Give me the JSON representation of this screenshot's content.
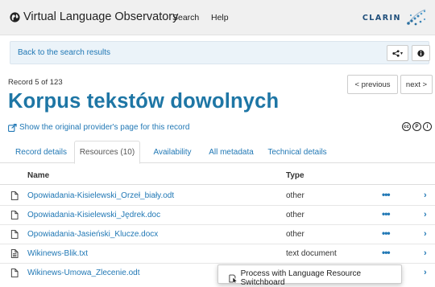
{
  "navbar": {
    "brand": "Virtual Language Observatory",
    "links": [
      "Search",
      "Help"
    ],
    "partner_logo_text": "CLARIN"
  },
  "searchbar": {
    "back_label": "Back to the search results",
    "share_icon": "share-icon",
    "info_icon": "info-icon"
  },
  "record": {
    "count_label": "Record 5 of 123",
    "prev_label": "< previous",
    "next_label": "next >",
    "title": "Korpus tekstów dowolnych",
    "provider_link": "Show the original provider's page for this record",
    "license_icons": [
      "cc",
      "P",
      "i"
    ]
  },
  "tabs": [
    {
      "label": "Record details",
      "active": false
    },
    {
      "label": "Resources (10)",
      "active": true
    },
    {
      "label": "Availability",
      "active": false
    },
    {
      "label": "All metadata",
      "active": false
    },
    {
      "label": "Technical details",
      "active": false
    }
  ],
  "resources": {
    "headers": {
      "name": "Name",
      "type": "Type"
    },
    "rows": [
      {
        "name": "Opowiadania-Kisielewski_Orzeł_biały.odt",
        "type": "other",
        "icon": "file-icon"
      },
      {
        "name": "Opowiadania-Kisielewski_Jędrek.doc",
        "type": "other",
        "icon": "file-icon"
      },
      {
        "name": "Opowiadania-Jasieński_Klucze.docx",
        "type": "other",
        "icon": "file-icon"
      },
      {
        "name": "Wikinews-Blik.txt",
        "type": "text document",
        "icon": "file-text-icon"
      },
      {
        "name": "Wikinews-Umowa_Zlecenie.odt",
        "type": "",
        "icon": "file-icon"
      }
    ],
    "dots_label": "•••",
    "chevron_label": "›"
  },
  "popup": {
    "label": "Process with Language Resource Switchboard"
  },
  "colors": {
    "link": "#2178b5",
    "title": "#1e76a5",
    "navbar_bg": "#f0f0f0",
    "searchbar_bg": "#ebf3f9"
  }
}
